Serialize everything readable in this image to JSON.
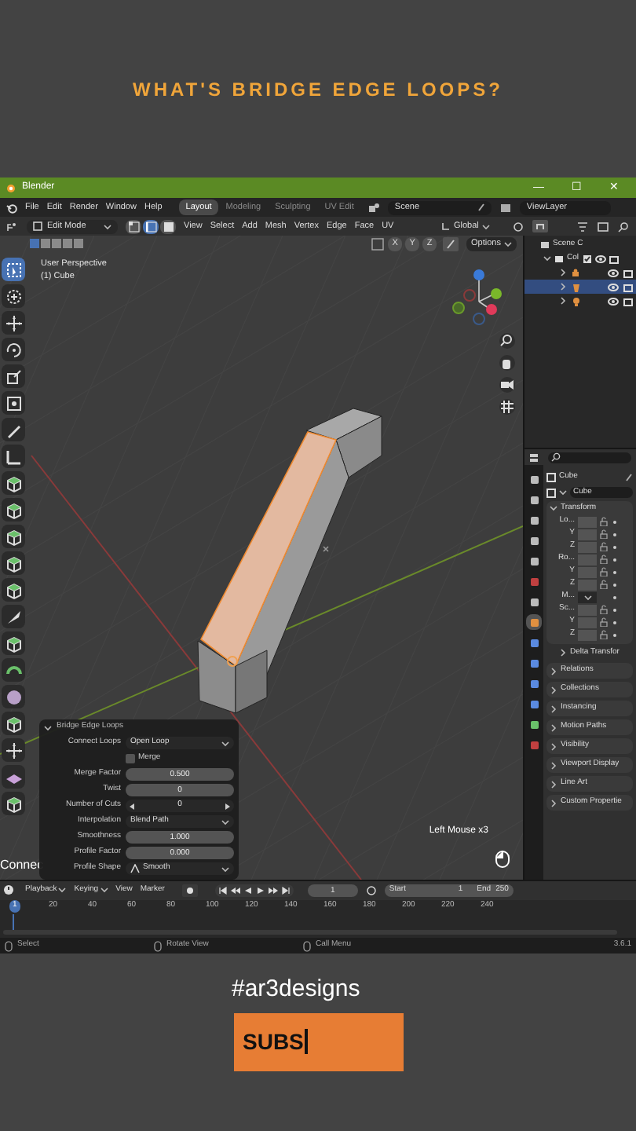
{
  "video_title": "WHAT'S BRIDGE EDGE LOOPS?",
  "window": {
    "title": "Blender",
    "controls": [
      "—",
      "☐",
      "✕"
    ]
  },
  "menu": [
    "File",
    "Edit",
    "Render",
    "Window",
    "Help"
  ],
  "workspaces": [
    {
      "label": "Layout",
      "selected": true
    },
    {
      "label": "Modeling",
      "selected": false
    },
    {
      "label": "Sculpting",
      "selected": false
    },
    {
      "label": "UV Edit",
      "selected": false
    }
  ],
  "scene": "Scene",
  "view_layer": "ViewLayer",
  "header": {
    "mode": "Edit Mode",
    "select_modes": [
      {
        "kind": "vertex",
        "selected": false
      },
      {
        "kind": "edge",
        "selected": true
      },
      {
        "kind": "face",
        "selected": false
      }
    ],
    "menus": [
      "View",
      "Select",
      "Add",
      "Mesh",
      "Vertex",
      "Edge",
      "Face",
      "UV"
    ],
    "orientation": "Global",
    "axes": [
      "X",
      "Y",
      "Z"
    ],
    "options": "Options"
  },
  "viewport": {
    "info": [
      "User Perspective",
      "(1) Cube"
    ],
    "last_key": "Left Mouse x3",
    "cut_label": "Connec"
  },
  "tools": [
    {
      "kind": "select",
      "selected": true
    },
    {
      "kind": "cursor",
      "selected": false
    },
    {
      "kind": "move",
      "selected": false
    },
    {
      "kind": "rotate",
      "selected": false
    },
    {
      "kind": "scale",
      "selected": false
    },
    {
      "kind": "transform",
      "selected": false
    },
    {
      "kind": "pencil",
      "selected": false
    },
    {
      "kind": "ruler",
      "selected": false
    },
    {
      "kind": "cube",
      "selected": false
    },
    {
      "kind": "cube",
      "selected": false
    },
    {
      "kind": "cube",
      "selected": false
    },
    {
      "kind": "cube",
      "selected": false
    },
    {
      "kind": "cube",
      "selected": false
    },
    {
      "kind": "knife",
      "selected": false
    },
    {
      "kind": "cube",
      "selected": false
    },
    {
      "kind": "spin",
      "selected": false
    },
    {
      "kind": "sphere",
      "selected": false
    },
    {
      "kind": "cube",
      "selected": false
    },
    {
      "kind": "move",
      "selected": false
    },
    {
      "kind": "slab",
      "selected": false
    },
    {
      "kind": "cube",
      "selected": false
    }
  ],
  "operator": {
    "title": "Bridge Edge Loops",
    "expanded": true,
    "rows": [
      {
        "kind": "dropdown",
        "label": "Connect Loops",
        "value": "Open Loop"
      },
      {
        "kind": "checkbox",
        "value": "Merge",
        "checked": false
      },
      {
        "kind": "number",
        "label": "Merge Factor",
        "value": "0.500"
      },
      {
        "kind": "number",
        "label": "Twist",
        "value": "0"
      },
      {
        "kind": "stepper",
        "label": "Number of Cuts",
        "value": "0"
      },
      {
        "kind": "dropdown",
        "label": "Interpolation",
        "value": "Blend Path"
      },
      {
        "kind": "number",
        "label": "Smoothness",
        "value": "1.000"
      },
      {
        "kind": "number",
        "label": "Profile Factor",
        "value": "0.000"
      },
      {
        "kind": "shape",
        "label": "Profile Shape",
        "value": "Smooth"
      }
    ]
  },
  "outliner": {
    "scene": "Scene C",
    "collection": "Col",
    "items": [
      {
        "kind": "camera",
        "selected": false
      },
      {
        "kind": "mesh",
        "selected": true
      },
      {
        "kind": "light",
        "selected": false
      }
    ]
  },
  "properties": {
    "tabs": [
      {
        "kind": "tool",
        "selected": false
      },
      {
        "kind": "render",
        "selected": false
      },
      {
        "kind": "output",
        "selected": false
      },
      {
        "kind": "view",
        "selected": false
      },
      {
        "kind": "scene",
        "selected": false
      },
      {
        "kind": "world",
        "selected": false
      },
      {
        "kind": "collection",
        "selected": false
      },
      {
        "kind": "object",
        "selected": true
      },
      {
        "kind": "modifier",
        "selected": false
      },
      {
        "kind": "particles",
        "selected": false
      },
      {
        "kind": "physics",
        "selected": false
      },
      {
        "kind": "constraints",
        "selected": false
      },
      {
        "kind": "data",
        "selected": false
      },
      {
        "kind": "material",
        "selected": false
      }
    ],
    "object": "Cube",
    "data_name": "Cube",
    "transform": {
      "title": "Transform",
      "expanded": true,
      "rows": [
        {
          "kind": "field",
          "label": "Lo..."
        },
        {
          "kind": "field",
          "label": "Y"
        },
        {
          "kind": "field",
          "label": "Z"
        },
        {
          "kind": "field",
          "label": "Ro..."
        },
        {
          "kind": "field",
          "label": "Y"
        },
        {
          "kind": "field",
          "label": "Z"
        },
        {
          "kind": "mode",
          "label": "M..."
        },
        {
          "kind": "field",
          "label": "Sc..."
        },
        {
          "kind": "field",
          "label": "Y"
        },
        {
          "kind": "field",
          "label": "Z"
        }
      ]
    },
    "panels": [
      {
        "label": "Delta Transfor",
        "expanded": false,
        "kind": "sub"
      },
      {
        "label": "Relations",
        "expanded": false,
        "kind": "panel"
      },
      {
        "label": "Collections",
        "expanded": false,
        "kind": "panel"
      },
      {
        "label": "Instancing",
        "expanded": false,
        "kind": "panel"
      },
      {
        "label": "Motion Paths",
        "expanded": false,
        "kind": "panel"
      },
      {
        "label": "Visibility",
        "expanded": false,
        "kind": "panel"
      },
      {
        "label": "Viewport Display",
        "expanded": false,
        "kind": "panel"
      },
      {
        "label": "Line Art",
        "expanded": false,
        "kind": "panel"
      },
      {
        "label": "Custom Propertie",
        "expanded": false,
        "kind": "panel"
      }
    ]
  },
  "timeline": {
    "menus": [
      "Playback",
      "Keying",
      "View",
      "Marker"
    ],
    "frame": "1",
    "start_label": "Start",
    "start": "1",
    "end_label": "End",
    "end": "250",
    "ruler": [
      {
        "label": "1",
        "selected": true
      },
      {
        "label": "20",
        "selected": false
      },
      {
        "label": "40",
        "selected": false
      },
      {
        "label": "60",
        "selected": false
      },
      {
        "label": "80",
        "selected": false
      },
      {
        "label": "100",
        "selected": false
      },
      {
        "label": "120",
        "selected": false
      },
      {
        "label": "140",
        "selected": false
      },
      {
        "label": "160",
        "selected": false
      },
      {
        "label": "180",
        "selected": false
      },
      {
        "label": "200",
        "selected": false
      },
      {
        "label": "220",
        "selected": false
      },
      {
        "label": "240",
        "selected": false
      }
    ]
  },
  "status": {
    "items": [
      "Select",
      "Rotate View",
      "Call Menu"
    ],
    "version": "3.6.1"
  },
  "hashtag": "#ar3designs",
  "subscribe": "SUBS"
}
